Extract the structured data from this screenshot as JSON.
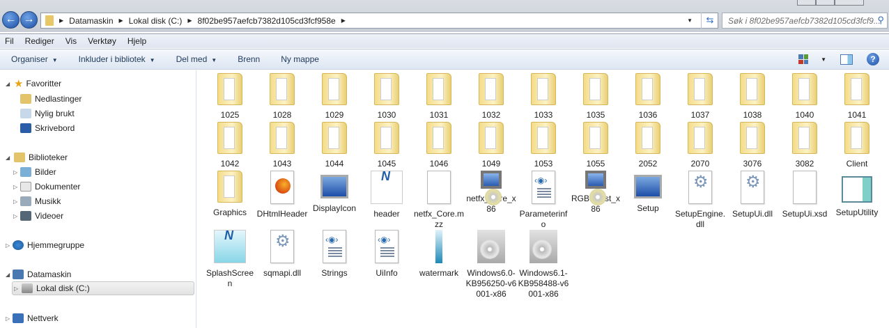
{
  "address": {
    "crumbs": [
      "Datamaskin",
      "Lokal disk (C:)",
      "8f02be957aefcb7382d105cd3fcf958e"
    ]
  },
  "search": {
    "placeholder": "Søk i 8f02be957aefcb7382d105cd3fcf9..."
  },
  "menu": [
    "Fil",
    "Rediger",
    "Vis",
    "Verktøy",
    "Hjelp"
  ],
  "toolbar": {
    "organise": "Organiser",
    "include": "Inkluder i bibliotek",
    "share": "Del med",
    "burn": "Brenn",
    "new_folder": "Ny mappe"
  },
  "sidebar": {
    "favorites": "Favoritter",
    "downloads": "Nedlastinger",
    "recent": "Nylig brukt",
    "desktop": "Skrivebord",
    "libraries": "Biblioteker",
    "pictures": "Bilder",
    "documents": "Dokumenter",
    "music": "Musikk",
    "videos": "Videoer",
    "homegroup": "Hjemmegruppe",
    "computer": "Datamaskin",
    "local_disk": "Lokal disk (C:)",
    "network": "Nettverk"
  },
  "items": [
    {
      "name": "1025",
      "icon": "folder"
    },
    {
      "name": "1028",
      "icon": "folder"
    },
    {
      "name": "1029",
      "icon": "folder"
    },
    {
      "name": "1030",
      "icon": "folder"
    },
    {
      "name": "1031",
      "icon": "folder"
    },
    {
      "name": "1032",
      "icon": "folder"
    },
    {
      "name": "1033",
      "icon": "folder"
    },
    {
      "name": "1035",
      "icon": "folder"
    },
    {
      "name": "1036",
      "icon": "folder"
    },
    {
      "name": "1037",
      "icon": "folder"
    },
    {
      "name": "1038",
      "icon": "folder"
    },
    {
      "name": "1040",
      "icon": "folder"
    },
    {
      "name": "1041",
      "icon": "folder"
    },
    {
      "name": "1042",
      "icon": "folder"
    },
    {
      "name": "1043",
      "icon": "folder"
    },
    {
      "name": "1044",
      "icon": "folder"
    },
    {
      "name": "1045",
      "icon": "folder"
    },
    {
      "name": "1046",
      "icon": "folder"
    },
    {
      "name": "1049",
      "icon": "folder"
    },
    {
      "name": "1053",
      "icon": "folder"
    },
    {
      "name": "1055",
      "icon": "folder"
    },
    {
      "name": "2052",
      "icon": "folder"
    },
    {
      "name": "2070",
      "icon": "folder"
    },
    {
      "name": "3076",
      "icon": "folder"
    },
    {
      "name": "3082",
      "icon": "folder"
    },
    {
      "name": "Client",
      "icon": "folder"
    },
    {
      "name": "Graphics",
      "icon": "folder"
    },
    {
      "name": "DHtmlHeader",
      "icon": "firefox-doc"
    },
    {
      "name": "DisplayIcon",
      "icon": "computer"
    },
    {
      "name": "header",
      "icon": "dotnet"
    },
    {
      "name": "netfx_Core.mzz",
      "icon": "blank-doc"
    },
    {
      "name": "netfx_Core_x86",
      "icon": "setup"
    },
    {
      "name": "Parameterinfo",
      "icon": "xml-doc"
    },
    {
      "name": "RGB9Rast_x86",
      "icon": "setup"
    },
    {
      "name": "Setup",
      "icon": "computer"
    },
    {
      "name": "SetupEngine.dll",
      "icon": "dll"
    },
    {
      "name": "SetupUi.dll",
      "icon": "dll"
    },
    {
      "name": "SetupUi.xsd",
      "icon": "blank-doc"
    },
    {
      "name": "SetupUtility",
      "icon": "utility"
    },
    {
      "name": "SplashScreen",
      "icon": "dotnet-blue"
    },
    {
      "name": "sqmapi.dll",
      "icon": "dll"
    },
    {
      "name": "Strings",
      "icon": "xml-doc"
    },
    {
      "name": "UiInfo",
      "icon": "xml-doc"
    },
    {
      "name": "watermark",
      "icon": "image"
    },
    {
      "name": "Windows6.0-KB956250-v6001-x86",
      "icon": "package"
    },
    {
      "name": "Windows6.1-KB958488-v6001-x86",
      "icon": "package"
    }
  ]
}
